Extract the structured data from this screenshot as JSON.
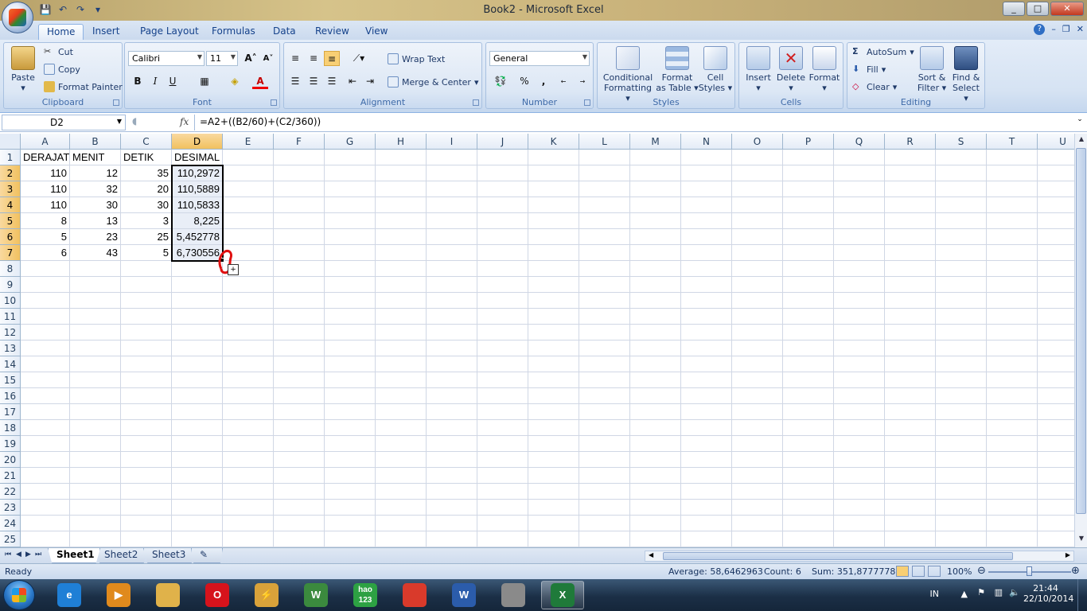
{
  "window": {
    "title": "Book2 - Microsoft Excel"
  },
  "qat": {
    "save_icon": "save-icon",
    "undo_icon": "undo-icon",
    "redo_icon": "redo-icon",
    "customize_icon": "dropdown-icon"
  },
  "tabs": [
    "Home",
    "Insert",
    "Page Layout",
    "Formulas",
    "Data",
    "Review",
    "View"
  ],
  "ribbon": {
    "clipboard": {
      "label": "Clipboard",
      "paste": "Paste",
      "cut": "Cut",
      "copy": "Copy",
      "format_painter": "Format Painter"
    },
    "font": {
      "label": "Font",
      "name": "Calibri",
      "size": "11",
      "bold": "B",
      "italic": "I",
      "underline": "U",
      "grow": "A",
      "shrink": "A",
      "font_color": "A"
    },
    "alignment": {
      "label": "Alignment",
      "wrap_text": "Wrap Text",
      "merge_center": "Merge & Center"
    },
    "number": {
      "label": "Number",
      "format": "General",
      "percent": "%",
      "comma": ",",
      "inc_decimal": ",0 ,00",
      "dec_decimal": ",00 ,0"
    },
    "styles": {
      "label": "Styles",
      "conditional": "Conditional",
      "conditional2": "Formatting",
      "format_table": "Format",
      "format_table2": "as Table",
      "cell_styles": "Cell",
      "cell_styles2": "Styles"
    },
    "cells": {
      "label": "Cells",
      "insert": "Insert",
      "delete": "Delete",
      "format": "Format"
    },
    "editing": {
      "label": "Editing",
      "autosum": "AutoSum",
      "fill": "Fill",
      "clear": "Clear",
      "sort": "Sort &",
      "sort2": "Filter",
      "find": "Find &",
      "find2": "Select"
    }
  },
  "formula_bar": {
    "name_box": "D2",
    "fx": "fx",
    "formula": "=A2+((B2/60)+(C2/360))"
  },
  "columns": [
    "A",
    "B",
    "C",
    "D",
    "E",
    "F",
    "G",
    "H",
    "I",
    "J",
    "K",
    "L",
    "M",
    "N",
    "O",
    "P",
    "Q",
    "R",
    "S",
    "T",
    "U"
  ],
  "rows": [
    "1",
    "2",
    "3",
    "4",
    "5",
    "6",
    "7",
    "8",
    "9",
    "10",
    "11",
    "12",
    "13",
    "14",
    "15",
    "16",
    "17",
    "18",
    "19",
    "20",
    "21",
    "22",
    "23",
    "24",
    "25"
  ],
  "sheet": {
    "headers": [
      "DERAJAT",
      "MENIT",
      "DETIK",
      "DESIMAL"
    ],
    "data": [
      [
        "110",
        "12",
        "35",
        "110,2972"
      ],
      [
        "110",
        "32",
        "20",
        "110,5889"
      ],
      [
        "110",
        "30",
        "30",
        "110,5833"
      ],
      [
        "8",
        "13",
        "3",
        "8,225"
      ],
      [
        "5",
        "23",
        "25",
        "5,452778"
      ],
      [
        "6",
        "43",
        "5",
        "6,730556"
      ]
    ]
  },
  "sheet_tabs": [
    "Sheet1",
    "Sheet2",
    "Sheet3"
  ],
  "status": {
    "ready": "Ready",
    "average": "Average: 58,6462963",
    "count": "Count: 6",
    "sum": "Sum: 351,8777778",
    "zoom": "100%"
  },
  "taskbar": {
    "apps": [
      {
        "name": "internet-explorer",
        "label": "e",
        "color": "#1f7fd6"
      },
      {
        "name": "media-player",
        "label": "▶",
        "color": "#e08a1d"
      },
      {
        "name": "file-explorer",
        "label": "",
        "color": "#e0b24a"
      },
      {
        "name": "opera",
        "label": "O",
        "color": "#d6131c"
      },
      {
        "name": "winamp",
        "label": "⚡",
        "color": "#d9a23a"
      },
      {
        "name": "document-app",
        "label": "W",
        "color": "#3b8a3e"
      },
      {
        "name": "hao123",
        "label": "hao 123",
        "color": "#2da143"
      },
      {
        "name": "chrome",
        "label": "",
        "color": "#d93a2b"
      },
      {
        "name": "word",
        "label": "W",
        "color": "#2b5cab"
      },
      {
        "name": "paint",
        "label": "",
        "color": "#8a8a8a"
      },
      {
        "name": "excel",
        "label": "X",
        "color": "#1f7a3a"
      }
    ],
    "language": "IN",
    "time": "21:44",
    "date": "22/10/2014"
  }
}
